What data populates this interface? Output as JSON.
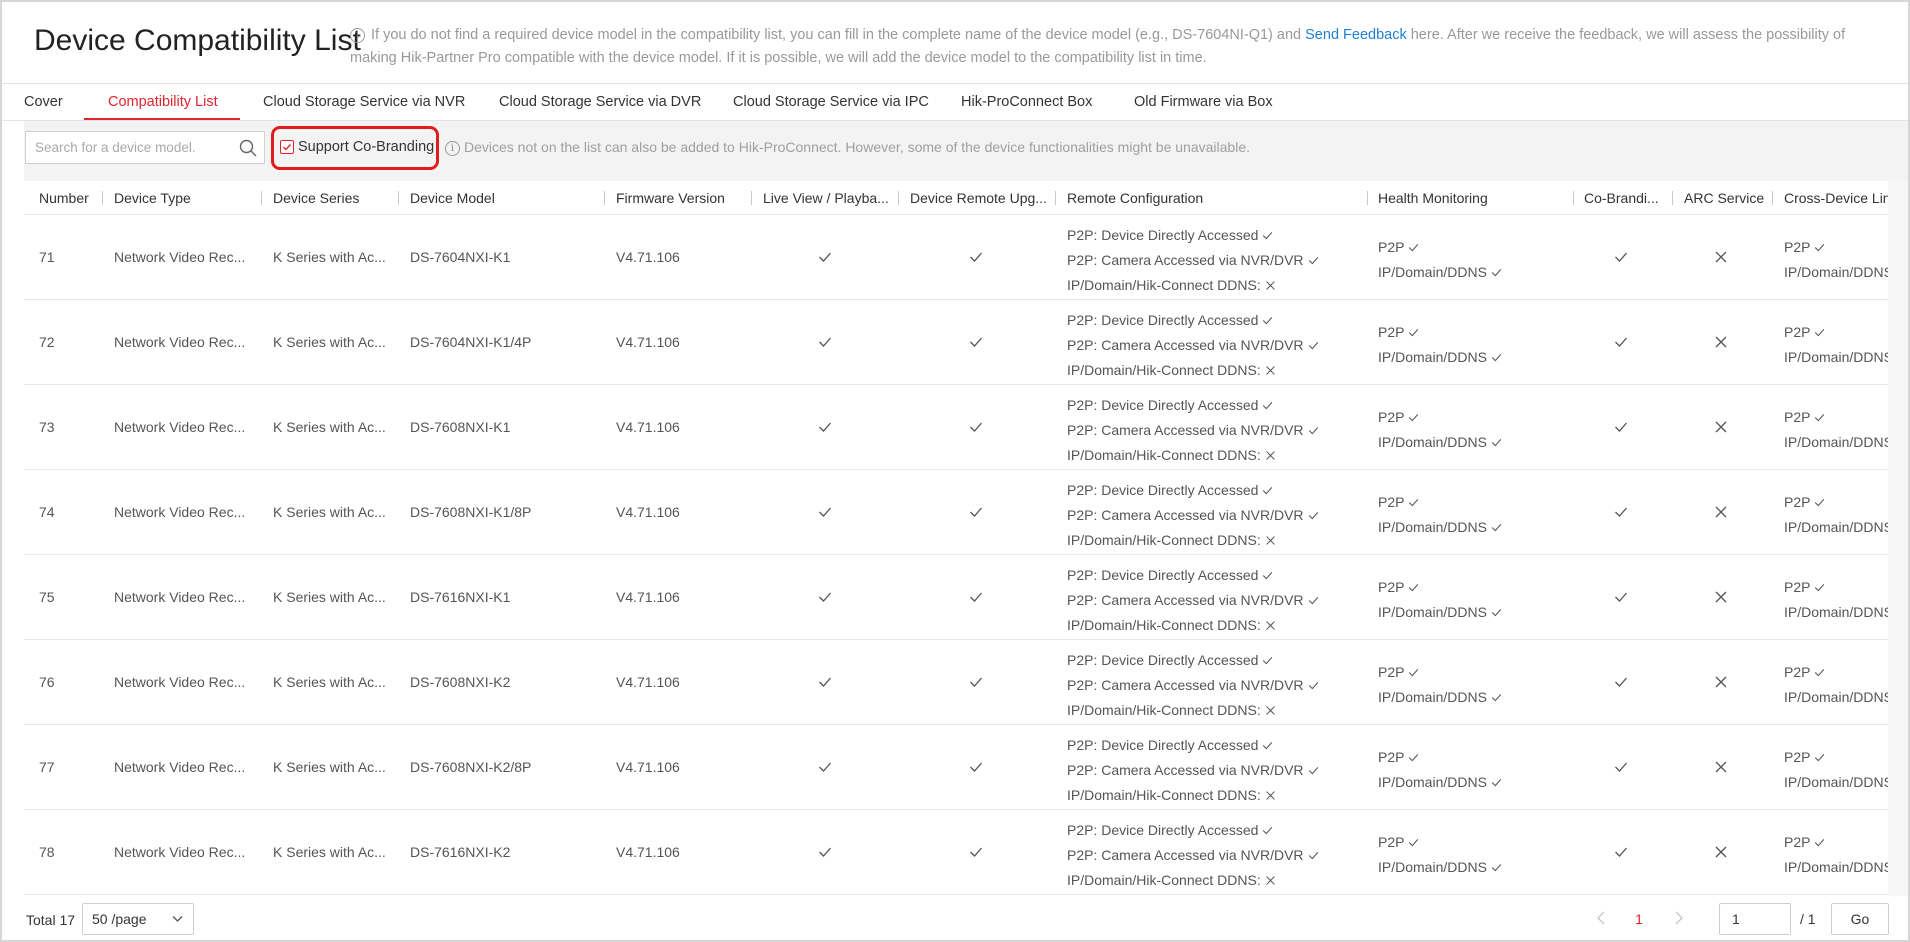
{
  "header": {
    "title": "Device Compatibility List",
    "info_text_before_link": "If you do not find a required device model in the compatibility list, you can fill in the complete name of the device model (e.g., DS-7604NI-Q1) and ",
    "info_link": "Send Feedback",
    "info_text_after_link": " here. After we receive the feedback, we will assess the possibility of making Hik-Partner Pro compatible with the device model. If it is possible, we will add the device model to the compatibility list in time."
  },
  "tabs": [
    {
      "label": "Cover"
    },
    {
      "label": "Compatibility List",
      "active": true
    },
    {
      "label": "Cloud Storage Service via NVR"
    },
    {
      "label": "Cloud Storage Service via DVR"
    },
    {
      "label": "Cloud Storage Service via IPC"
    },
    {
      "label": "Hik-ProConnect Box"
    },
    {
      "label": "Old Firmware via Box"
    }
  ],
  "toolbar": {
    "search_placeholder": "Search for a device model.",
    "search_value": "",
    "cobranding_label": "Support Co-Branding",
    "cobranding_checked": true,
    "note": "Devices not on the list can also be added to Hik-ProConnect. However, some of the device functionalities might be unavailable."
  },
  "table": {
    "columns": [
      "Number",
      "Device Type",
      "Device Series",
      "Device Model",
      "Firmware Version",
      "Live View / Playba...",
      "Device Remote Upg...",
      "Remote Configuration",
      "Health Monitoring",
      "Co-Brandi...",
      "ARC Service",
      "Cross-Device Lin"
    ],
    "remote_config_lines": [
      "P2P: Device Directly Accessed",
      "P2P: Camera Accessed via NVR/DVR",
      "IP/Domain/Hik-Connect DDNS:"
    ],
    "health_lines": [
      "P2P",
      "IP/Domain/DDNS"
    ],
    "cross_device_lines": [
      "P2P",
      "IP/Domain/DDNS"
    ],
    "rows": [
      {
        "number": "71",
        "type": "Network Video Rec...",
        "series": "K Series with Ac...",
        "model": "DS-7604NXI-K1",
        "firmware": "V4.71.106"
      },
      {
        "number": "72",
        "type": "Network Video Rec...",
        "series": "K Series with Ac...",
        "model": "DS-7604NXI-K1/4P",
        "firmware": "V4.71.106"
      },
      {
        "number": "73",
        "type": "Network Video Rec...",
        "series": "K Series with Ac...",
        "model": "DS-7608NXI-K1",
        "firmware": "V4.71.106"
      },
      {
        "number": "74",
        "type": "Network Video Rec...",
        "series": "K Series with Ac...",
        "model": "DS-7608NXI-K1/8P",
        "firmware": "V4.71.106"
      },
      {
        "number": "75",
        "type": "Network Video Rec...",
        "series": "K Series with Ac...",
        "model": "DS-7616NXI-K1",
        "firmware": "V4.71.106"
      },
      {
        "number": "76",
        "type": "Network Video Rec...",
        "series": "K Series with Ac...",
        "model": "DS-7608NXI-K2",
        "firmware": "V4.71.106"
      },
      {
        "number": "77",
        "type": "Network Video Rec...",
        "series": "K Series with Ac...",
        "model": "DS-7608NXI-K2/8P",
        "firmware": "V4.71.106"
      },
      {
        "number": "78",
        "type": "Network Video Rec...",
        "series": "K Series with Ac...",
        "model": "DS-7616NXI-K2",
        "firmware": "V4.71.106"
      }
    ]
  },
  "footer": {
    "total": "Total 17",
    "page_size": "50 /page",
    "current_page": "1",
    "goto_value": "1",
    "page_total": "/ 1",
    "go_label": "Go"
  },
  "colors": {
    "accent": "#e0262c",
    "link": "#1e7fd8",
    "highlight": "#e01d1d"
  },
  "icons": {
    "check": "check-icon",
    "cross": "cross-icon",
    "search": "search-icon",
    "info": "info-icon",
    "dropdown": "chevron-down-icon",
    "prev": "chevron-left-icon",
    "next": "chevron-right-icon"
  }
}
